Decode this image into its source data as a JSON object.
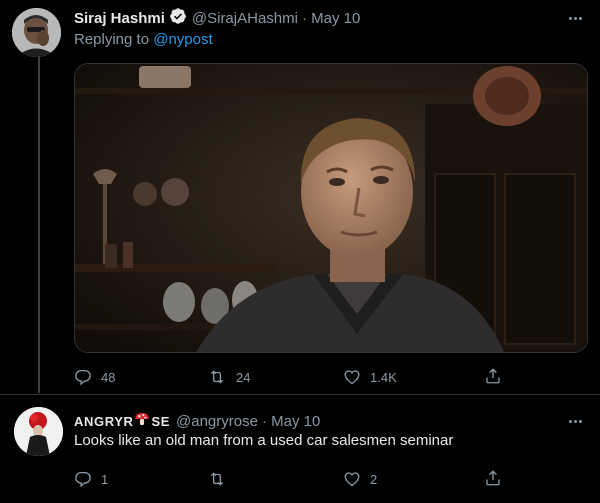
{
  "tweet_1": {
    "display_name": "Siraj Hashmi",
    "handle": "@SirajAHashmi",
    "date": "· May 10",
    "replying_prefix": "Replying to",
    "replying_to": "@nypost",
    "actions": {
      "reply_count": "48",
      "retweet_count": "24",
      "like_count": "1.4K"
    }
  },
  "tweet_2": {
    "display_name_part1": "ANGRYR",
    "display_name_part2": "SE",
    "handle": "@angryrose",
    "date": "· May 10",
    "text": "Looks like an old man from a used car salesmen seminar",
    "actions": {
      "reply_count": "1",
      "retweet_count": "",
      "like_count": "2"
    }
  },
  "icons": {
    "verified_badge": "verified-badge-icon",
    "more": "more-horizontal-icon",
    "reply": "reply-bubble-icon",
    "retweet": "retweet-icon",
    "like": "heart-icon",
    "share": "share-icon",
    "mushroom": "mushroom-icon"
  },
  "colors": {
    "background": "#000000",
    "link": "#1d9bf0",
    "muted": "#8b98a5",
    "text": "#e7e9ea"
  }
}
